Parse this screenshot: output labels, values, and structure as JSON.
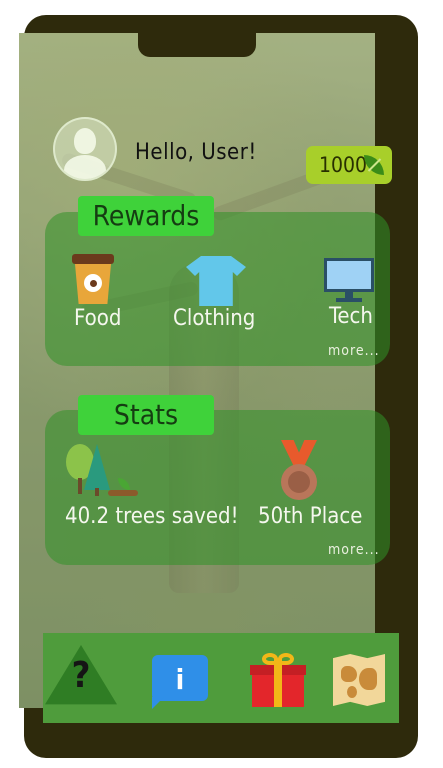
{
  "header": {
    "greeting": "Hello, User!",
    "coin_balance": "1000"
  },
  "rewards": {
    "title": "Rewards",
    "items": [
      {
        "label": "Food",
        "icon": "coffee-cup-icon"
      },
      {
        "label": "Clothing",
        "icon": "tshirt-icon"
      },
      {
        "label": "Tech",
        "icon": "monitor-icon"
      }
    ],
    "more": "more..."
  },
  "stats": {
    "title": "Stats",
    "trees_saved": "40.2 trees saved!",
    "place": "50th Place",
    "more": "more..."
  },
  "nav": {
    "items": [
      "recycle-help-icon",
      "info-icon",
      "gift-icon",
      "map-icon"
    ]
  },
  "colors": {
    "panel": "#329128",
    "tab": "#3fd23a",
    "coin_badge": "#a8cf2a",
    "navbar": "#4f9c3c",
    "phone_frame": "#2e2a0c"
  }
}
